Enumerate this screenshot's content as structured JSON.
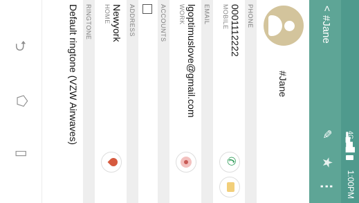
{
  "status_bar": {
    "time": "1:00PM",
    "network": "4G",
    "signal": "▂▄▆█"
  },
  "action_bar": {
    "back": "<",
    "title": "#Jane",
    "edit_icon": "✎",
    "star_icon": "★",
    "more_icon": "⋮"
  },
  "contact": {
    "name": "#Jane"
  },
  "sections": {
    "phone": "PHONE",
    "email": "EMAIL",
    "accounts": "ACCOUNTS",
    "address": "ADDRESS",
    "ringtone": "RINGTONE"
  },
  "phone": {
    "number": "0001112222",
    "type": "MOBILE"
  },
  "email": {
    "address": "lgoptimuslove@gmail.com",
    "type": "WORK"
  },
  "address": {
    "value": "Newyork",
    "type": "HOME"
  },
  "ringtone": {
    "value": "Default ringtone (VZW Airwaves)"
  },
  "nav": {
    "back": "⮌",
    "home": "⬠",
    "recent": "▯"
  },
  "colors": {
    "accent": "#5ea596",
    "status_bar": "#4f9a8d",
    "avatar": "#d3c49c",
    "call": "#2e9b57",
    "map_pin": "#d65a3f"
  }
}
